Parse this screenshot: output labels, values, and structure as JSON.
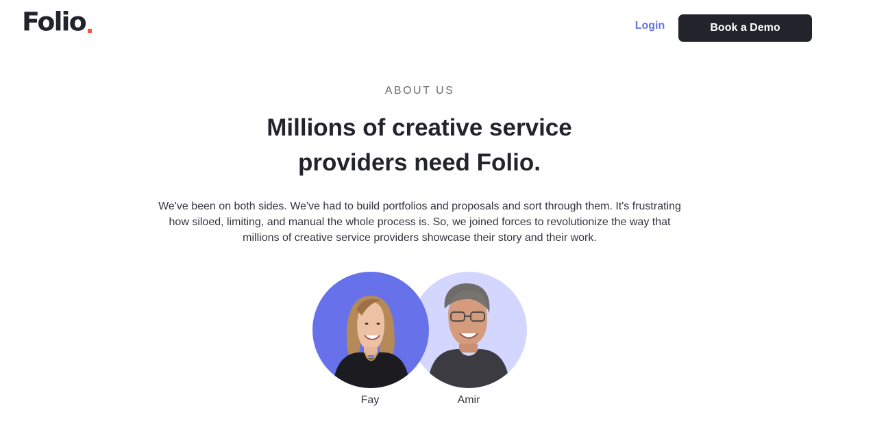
{
  "brand": {
    "logo_text": "Folio",
    "accent_color": "#f0573b"
  },
  "nav": {
    "login_label": "Login",
    "demo_button_label": "Book a Demo",
    "link_color": "#6872e8",
    "button_color": "#23232b"
  },
  "about": {
    "eyebrow": "ABOUT US",
    "headline_line_1": "Millions of creative service",
    "headline_line_2": "providers need Folio.",
    "description": "We've been on both sides. We've had to build portfolios and proposals and sort through them. It's frustrating how siloed, limiting, and manual the whole process is. So, we joined forces to revolutionize the way that millions of creative service providers showcase their story and their work."
  },
  "team": [
    {
      "name": "Fay",
      "background_color": "#6771ea"
    },
    {
      "name": "Amir",
      "background_color": "#d3d6ff"
    }
  ]
}
